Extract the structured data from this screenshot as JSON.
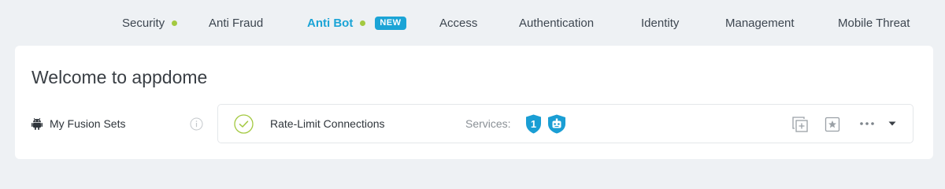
{
  "nav": {
    "items": [
      {
        "label": "Security",
        "dot": true
      },
      {
        "label": "Anti Fraud"
      },
      {
        "label": "Anti Bot",
        "dot": true,
        "badge": "NEW",
        "active": true
      },
      {
        "label": "Access"
      },
      {
        "label": "Authentication"
      },
      {
        "label": "Identity"
      },
      {
        "label": "Management"
      },
      {
        "label": "Mobile Threat"
      }
    ]
  },
  "main": {
    "title": "Welcome to appdome",
    "fusion_sets_label": "My Fusion Sets",
    "fusion_set": {
      "name": "Rate-Limit Connections",
      "services_label": "Services:",
      "service_icons": [
        "shield-number-icon",
        "bot-shield-icon"
      ],
      "shield_number": "1"
    },
    "actions": [
      "duplicate-icon",
      "favorite-star-icon",
      "more-options-icon",
      "expand-caret-icon"
    ]
  },
  "colors": {
    "accent": "#1ba4d6",
    "status_dot": "#a3c940",
    "badge_bg": "#1ba4d6",
    "check": "#a3c940"
  }
}
